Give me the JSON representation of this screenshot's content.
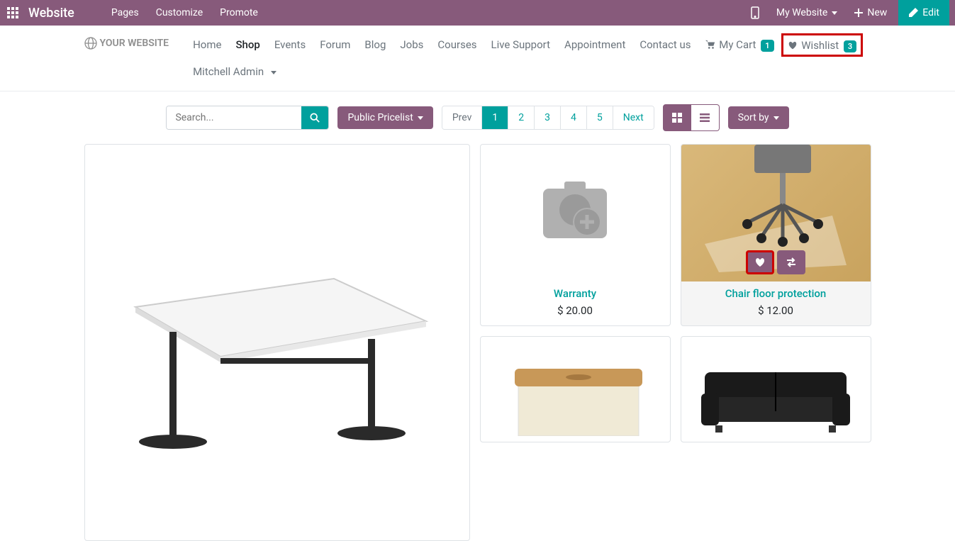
{
  "topbar": {
    "app_title": "Website",
    "links": [
      "Pages",
      "Customize",
      "Promote"
    ],
    "my_site": "My Website",
    "new": "New",
    "edit": "Edit"
  },
  "logo": "YOUR WEBSITE",
  "nav": {
    "items": [
      {
        "label": "Home"
      },
      {
        "label": "Shop",
        "active": true
      },
      {
        "label": "Events"
      },
      {
        "label": "Forum"
      },
      {
        "label": "Blog"
      },
      {
        "label": "Jobs"
      },
      {
        "label": "Courses"
      },
      {
        "label": "Live Support"
      },
      {
        "label": "Appointment"
      },
      {
        "label": "Contact us"
      }
    ],
    "cart": {
      "label": "My Cart",
      "count": "1"
    },
    "wishlist": {
      "label": "Wishlist",
      "count": "3"
    },
    "user": "Mitchell Admin"
  },
  "toolbar": {
    "search_placeholder": "Search...",
    "pricelist": "Public Pricelist",
    "pages": [
      "Prev",
      "1",
      "2",
      "3",
      "4",
      "5",
      "Next"
    ],
    "sort": "Sort by"
  },
  "products": {
    "warranty": {
      "title": "Warranty",
      "price": "$ 20.00"
    },
    "chair": {
      "title": "Chair floor protection",
      "price": "$ 12.00"
    }
  }
}
